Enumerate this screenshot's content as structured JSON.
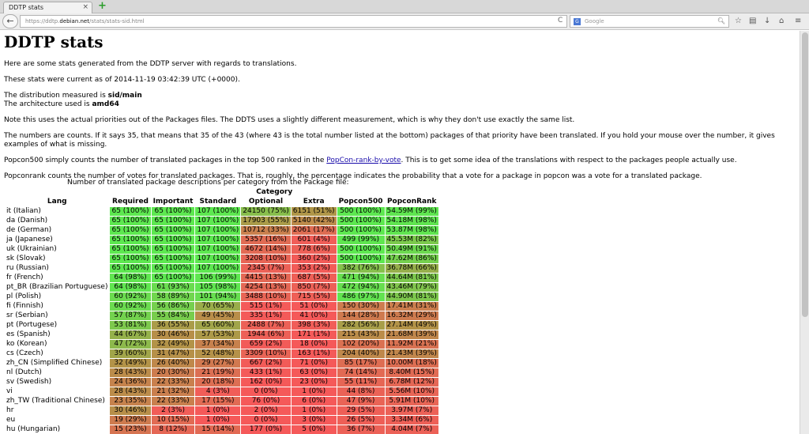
{
  "browser": {
    "tab_title": "DDTP stats",
    "tab_close": "×",
    "newtab": "+",
    "url_prefix": "https://ddtp.",
    "url_domain": "debian.net",
    "url_path": "/stats/stats-sid.html",
    "search_placeholder": "Google",
    "search_engine": "G",
    "back": "←",
    "reload": "C"
  },
  "page": {
    "title": "DDTP stats",
    "intro": "Here are some stats generated from the DDTP server with regards to translations.",
    "current": "These stats were current as of 2014-11-19 03:42:39 UTC (+0000).",
    "dist_label": "The distribution measured is ",
    "dist_value": "sid/main",
    "arch_label": "The architecture used is ",
    "arch_value": "amd64",
    "note": "Note this uses the actual priorities out of the Packages files. The DDTS uses a slightly different measurement, which is why they don't use exactly the same list.",
    "numbers": "The numbers are counts. If it says 35, that means that 35 of the 43 (where 43 is the total number listed at the bottom) packages of that priority have been translated. If you hold your mouse over the number, it gives examples of what is missing.",
    "popcon500_a": "Popcon500 simply counts the number of translated packages in the top 500 ranked in the ",
    "popcon500_link": "PopCon-rank-by-vote",
    "popcon500_b": ". This is to get some idea of the translations with respect to the packages people actually use.",
    "popconrank": "Popconrank counts the number of votes for translated packages. That is, roughly, the percentage indicates the probability that a vote for a package in popcon was a vote for a translated package.",
    "caption": "Number of translated package descriptions per category from the Package file:"
  },
  "table": {
    "category_header": "Category",
    "lang_header": "Lang",
    "columns": [
      "Required",
      "Important",
      "Standard",
      "Optional",
      "Extra",
      "Popcon500",
      "PopconRank"
    ],
    "rows": [
      {
        "lang": "it (Italian)",
        "cells": [
          "65 (100%)",
          "65 (100%)",
          "107 (100%)",
          "24150 (75%)",
          "6151 (51%)",
          "500 (100%)",
          "54.59M (99%)"
        ],
        "pct": [
          100,
          100,
          100,
          75,
          51,
          100,
          99
        ]
      },
      {
        "lang": "da (Danish)",
        "cells": [
          "65 (100%)",
          "65 (100%)",
          "107 (100%)",
          "17903 (55%)",
          "5140 (42%)",
          "500 (100%)",
          "54.18M (98%)"
        ],
        "pct": [
          100,
          100,
          100,
          55,
          42,
          100,
          98
        ]
      },
      {
        "lang": "de (German)",
        "cells": [
          "65 (100%)",
          "65 (100%)",
          "107 (100%)",
          "10712 (33%)",
          "2061 (17%)",
          "500 (100%)",
          "53.87M (98%)"
        ],
        "pct": [
          100,
          100,
          100,
          33,
          17,
          100,
          98
        ]
      },
      {
        "lang": "ja (Japanese)",
        "cells": [
          "65 (100%)",
          "65 (100%)",
          "107 (100%)",
          "5357 (16%)",
          "601 (4%)",
          "499 (99%)",
          "45.53M (82%)"
        ],
        "pct": [
          100,
          100,
          100,
          16,
          4,
          99,
          82
        ]
      },
      {
        "lang": "uk (Ukrainian)",
        "cells": [
          "65 (100%)",
          "65 (100%)",
          "107 (100%)",
          "4672 (14%)",
          "778 (6%)",
          "500 (100%)",
          "50.49M (91%)"
        ],
        "pct": [
          100,
          100,
          100,
          14,
          6,
          100,
          91
        ]
      },
      {
        "lang": "sk (Slovak)",
        "cells": [
          "65 (100%)",
          "65 (100%)",
          "107 (100%)",
          "3208 (10%)",
          "360 (2%)",
          "500 (100%)",
          "47.62M (86%)"
        ],
        "pct": [
          100,
          100,
          100,
          10,
          2,
          100,
          86
        ]
      },
      {
        "lang": "ru (Russian)",
        "cells": [
          "65 (100%)",
          "65 (100%)",
          "107 (100%)",
          "2345 (7%)",
          "353 (2%)",
          "382 (76%)",
          "36.78M (66%)"
        ],
        "pct": [
          100,
          100,
          100,
          7,
          2,
          76,
          66
        ]
      },
      {
        "lang": "fr (French)",
        "cells": [
          "64 (98%)",
          "65 (100%)",
          "106 (99%)",
          "4415 (13%)",
          "687 (5%)",
          "471 (94%)",
          "44.64M (81%)"
        ],
        "pct": [
          98,
          100,
          99,
          13,
          5,
          94,
          81
        ]
      },
      {
        "lang": "pt_BR (Brazilian Portuguese)",
        "cells": [
          "64 (98%)",
          "61 (93%)",
          "105 (98%)",
          "4254 (13%)",
          "850 (7%)",
          "472 (94%)",
          "43.46M (79%)"
        ],
        "pct": [
          98,
          93,
          98,
          13,
          7,
          94,
          79
        ]
      },
      {
        "lang": "pl (Polish)",
        "cells": [
          "60 (92%)",
          "58 (89%)",
          "101 (94%)",
          "3488 (10%)",
          "715 (5%)",
          "486 (97%)",
          "44.90M (81%)"
        ],
        "pct": [
          92,
          89,
          94,
          10,
          5,
          97,
          81
        ]
      },
      {
        "lang": "fi (Finnish)",
        "cells": [
          "60 (92%)",
          "56 (86%)",
          "70 (65%)",
          "515 (1%)",
          "51 (0%)",
          "150 (30%)",
          "17.41M (31%)"
        ],
        "pct": [
          92,
          86,
          65,
          1,
          0,
          30,
          31
        ]
      },
      {
        "lang": "sr (Serbian)",
        "cells": [
          "57 (87%)",
          "55 (84%)",
          "49 (45%)",
          "335 (1%)",
          "41 (0%)",
          "144 (28%)",
          "16.32M (29%)"
        ],
        "pct": [
          87,
          84,
          45,
          1,
          0,
          28,
          29
        ]
      },
      {
        "lang": "pt (Portugese)",
        "cells": [
          "53 (81%)",
          "36 (55%)",
          "65 (60%)",
          "2488 (7%)",
          "398 (3%)",
          "282 (56%)",
          "27.14M (49%)"
        ],
        "pct": [
          81,
          55,
          60,
          7,
          3,
          56,
          49
        ]
      },
      {
        "lang": "es (Spanish)",
        "cells": [
          "44 (67%)",
          "30 (46%)",
          "57 (53%)",
          "1944 (6%)",
          "171 (1%)",
          "215 (43%)",
          "21.68M (39%)"
        ],
        "pct": [
          67,
          46,
          53,
          6,
          1,
          43,
          39
        ]
      },
      {
        "lang": "ko (Korean)",
        "cells": [
          "47 (72%)",
          "32 (49%)",
          "37 (34%)",
          "659 (2%)",
          "18 (0%)",
          "102 (20%)",
          "11.92M (21%)"
        ],
        "pct": [
          72,
          49,
          34,
          2,
          0,
          20,
          21
        ]
      },
      {
        "lang": "cs (Czech)",
        "cells": [
          "39 (60%)",
          "31 (47%)",
          "52 (48%)",
          "3309 (10%)",
          "163 (1%)",
          "204 (40%)",
          "21.43M (39%)"
        ],
        "pct": [
          60,
          47,
          48,
          10,
          1,
          40,
          39
        ]
      },
      {
        "lang": "zh_CN (Simplified Chinese)",
        "cells": [
          "32 (49%)",
          "26 (40%)",
          "29 (27%)",
          "667 (2%)",
          "71 (0%)",
          "85 (17%)",
          "10.00M (18%)"
        ],
        "pct": [
          49,
          40,
          27,
          2,
          0,
          17,
          18
        ]
      },
      {
        "lang": "nl (Dutch)",
        "cells": [
          "28 (43%)",
          "20 (30%)",
          "21 (19%)",
          "433 (1%)",
          "63 (0%)",
          "74 (14%)",
          "8.40M (15%)"
        ],
        "pct": [
          43,
          30,
          19,
          1,
          0,
          14,
          15
        ]
      },
      {
        "lang": "sv (Swedish)",
        "cells": [
          "24 (36%)",
          "22 (33%)",
          "20 (18%)",
          "162 (0%)",
          "23 (0%)",
          "55 (11%)",
          "6.78M (12%)"
        ],
        "pct": [
          36,
          33,
          18,
          0,
          0,
          11,
          12
        ]
      },
      {
        "lang": "vi",
        "cells": [
          "28 (43%)",
          "21 (32%)",
          "4 (3%)",
          "0 (0%)",
          "1 (0%)",
          "44 (8%)",
          "5.56M (10%)"
        ],
        "pct": [
          43,
          32,
          3,
          0,
          0,
          8,
          10
        ]
      },
      {
        "lang": "zh_TW (Traditional Chinese)",
        "cells": [
          "23 (35%)",
          "22 (33%)",
          "17 (15%)",
          "76 (0%)",
          "6 (0%)",
          "47 (9%)",
          "5.91M (10%)"
        ],
        "pct": [
          35,
          33,
          15,
          0,
          0,
          9,
          10
        ]
      },
      {
        "lang": "hr",
        "cells": [
          "30 (46%)",
          "2 (3%)",
          "1 (0%)",
          "2 (0%)",
          "1 (0%)",
          "29 (5%)",
          "3.97M (7%)"
        ],
        "pct": [
          46,
          3,
          0,
          0,
          0,
          5,
          7
        ]
      },
      {
        "lang": "eu",
        "cells": [
          "19 (29%)",
          "10 (15%)",
          "1 (0%)",
          "0 (0%)",
          "3 (0%)",
          "26 (5%)",
          "3.34M (6%)"
        ],
        "pct": [
          29,
          15,
          0,
          0,
          0,
          5,
          6
        ]
      },
      {
        "lang": "hu (Hungarian)",
        "cells": [
          "15 (23%)",
          "8 (12%)",
          "15 (14%)",
          "177 (0%)",
          "5 (0%)",
          "36 (7%)",
          "4.04M (7%)"
        ],
        "pct": [
          23,
          12,
          14,
          0,
          0,
          7,
          7
        ]
      }
    ]
  }
}
